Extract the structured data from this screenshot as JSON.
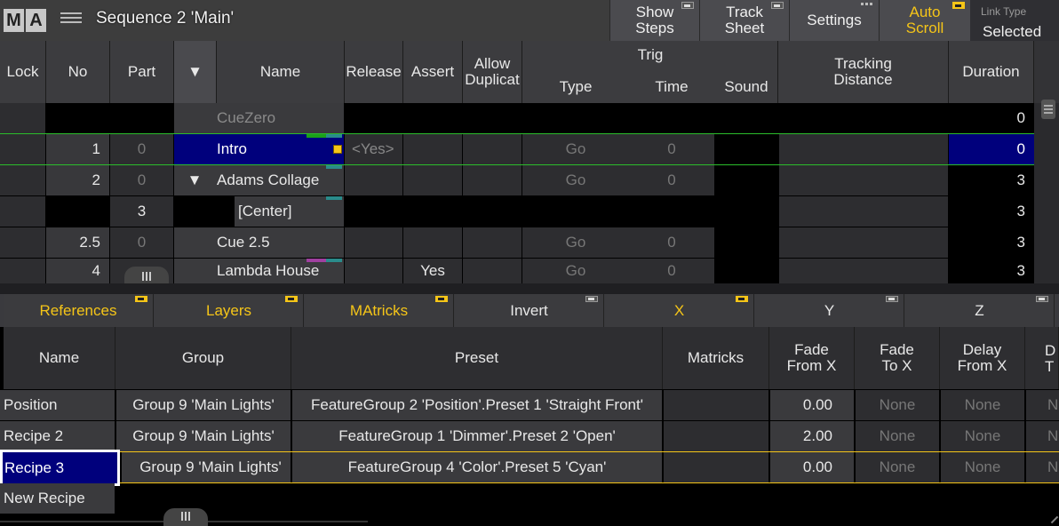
{
  "titlebar": {
    "logo_left": "M",
    "logo_right": "A",
    "title": "Sequence 2 'Main'",
    "buttons": [
      {
        "label_line1": "Show",
        "label_line2": "Steps"
      },
      {
        "label_line1": "Track",
        "label_line2": "Sheet"
      },
      {
        "label_line1": "Settings",
        "label_line2": ""
      },
      {
        "label_line1": "Auto",
        "label_line2": "Scroll"
      }
    ],
    "link_type_label": "Link Type",
    "link_type_value": "Selected"
  },
  "sequence": {
    "headers": {
      "lock": "Lock",
      "no": "No",
      "part": "Part",
      "sort_arrow": "▼",
      "name": "Name",
      "release": "Release",
      "assert": "Assert",
      "allow_dup_1": "Allow",
      "allow_dup_2": "Duplicat",
      "trig": "Trig",
      "type": "Type",
      "time": "Time",
      "sound": "Sound",
      "tracking_1": "Tracking",
      "tracking_2": "Distance",
      "duration": "Duration"
    },
    "rows": [
      {
        "no": "",
        "part": "",
        "name": "CueZero",
        "release": "",
        "assert": "",
        "type": "",
        "time": "",
        "duration": "0"
      },
      {
        "no": "1",
        "part": "0",
        "name": "Intro",
        "release": "<Yes>",
        "assert": "",
        "type": "Go",
        "time": "0",
        "duration": "0"
      },
      {
        "no": "2",
        "part": "0",
        "name": "Adams  Collage",
        "expand": "▼",
        "release": "",
        "assert": "",
        "type": "Go",
        "time": "0",
        "duration": "3"
      },
      {
        "no": "",
        "part": "3",
        "name": "[Center]",
        "release": "",
        "assert": "",
        "type": "",
        "time": "",
        "duration": "3"
      },
      {
        "no": "2.5",
        "part": "0",
        "name": "Cue  2.5",
        "release": "",
        "assert": "",
        "type": "Go",
        "time": "0",
        "duration": "3"
      },
      {
        "no": "4",
        "part": "",
        "name": "Lambda  House",
        "release": "",
        "assert": "Yes",
        "type": "Go",
        "time": "0",
        "duration": "3"
      }
    ]
  },
  "tabs": [
    {
      "label": "References",
      "active": true
    },
    {
      "label": "Layers",
      "active": true
    },
    {
      "label": "MAtricks",
      "active": true
    },
    {
      "label": "Invert",
      "active": false
    },
    {
      "label": "X",
      "active": true
    },
    {
      "label": "Y",
      "active": false
    },
    {
      "label": "Z",
      "active": false
    }
  ],
  "presets": {
    "headers": {
      "name": "Name",
      "group": "Group",
      "preset": "Preset",
      "matricks": "Matricks",
      "fade_from_1": "Fade",
      "fade_from_2": "From X",
      "fade_to_1": "Fade",
      "fade_to_2": "To X",
      "delay_from_1": "Delay",
      "delay_from_2": "From X",
      "delay_to_1": "D",
      "delay_to_2": "T"
    },
    "rows": [
      {
        "name": "Position",
        "group": "Group 9 'Main Lights'",
        "preset": "FeatureGroup 2 'Position'.Preset 1 'Straight Front'",
        "fade_from": "0.00",
        "fade_to": "None",
        "delay_from": "None",
        "delay_to": "N"
      },
      {
        "name": "Recipe 2",
        "group": "Group 9 'Main Lights'",
        "preset": "FeatureGroup 1 'Dimmer'.Preset 2 'Open'",
        "fade_from": "2.00",
        "fade_to": "None",
        "delay_from": "None",
        "delay_to": "N"
      },
      {
        "name": "Recipe 3",
        "group": "Group 9 'Main Lights'",
        "preset": "FeatureGroup 4 'Color'.Preset 5 'Cyan'",
        "fade_from": "0.00",
        "fade_to": "None",
        "delay_from": "None",
        "delay_to": "N"
      }
    ],
    "new_recipe": "New Recipe"
  },
  "colors": {
    "accent_yellow": "#f5c518",
    "selection_blue": "#00007c",
    "active_row_green": "#2bbd2b"
  }
}
